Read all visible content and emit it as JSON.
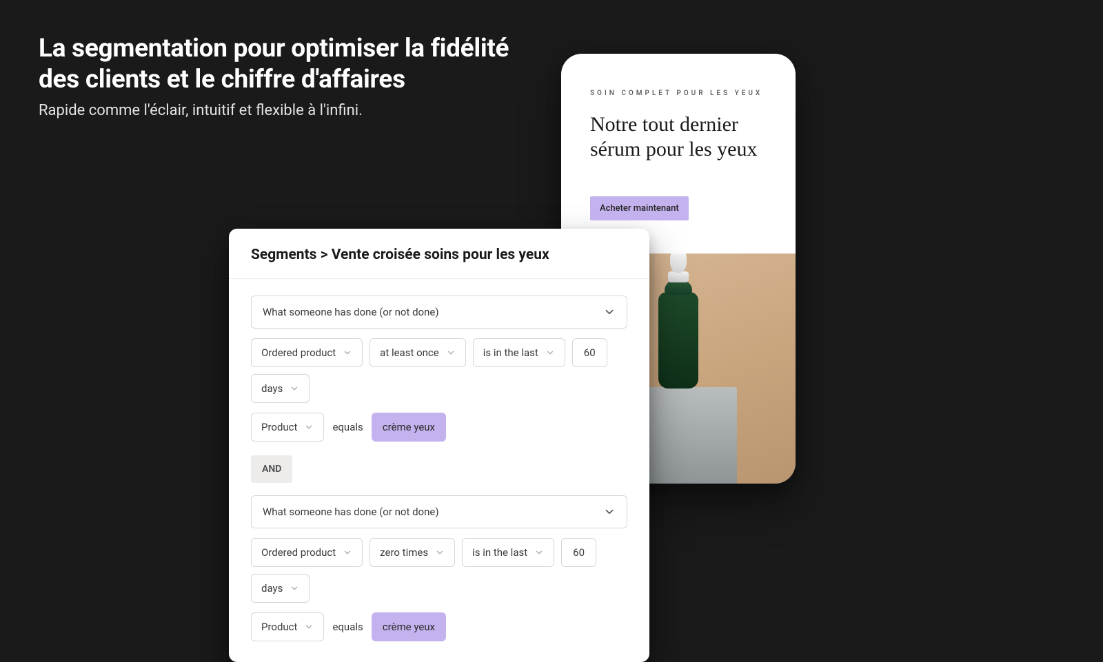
{
  "headline": {
    "title": "La segmentation pour optimiser la fidélité des clients et le chiffre d'affaires",
    "subtitle": "Rapide comme l'éclair, intuitif et flexible à l'infini."
  },
  "phone": {
    "eyebrow": "SOIN COMPLET POUR LES YEUX",
    "title": "Notre tout dernier sérum pour les yeux",
    "cta": "Acheter maintenant"
  },
  "segment_card": {
    "breadcrumb_root": "Segments",
    "breadcrumb_sep": " > ",
    "breadcrumb_name": "Vente croisée soins pour les yeux",
    "blocks": [
      {
        "condition": "What someone has done (or not done)",
        "event": "Ordered product",
        "frequency": "at least once",
        "timeframe": "is in the last",
        "count": "60",
        "unit": "days",
        "filter_field": "Product",
        "filter_op": "equals",
        "filter_value": "crème yeux"
      },
      {
        "condition": "What someone has done (or not done)",
        "event": "Ordered product",
        "frequency": "zero times",
        "timeframe": "is in the last",
        "count": "60",
        "unit": "days",
        "filter_field": "Product",
        "filter_op": "equals",
        "filter_value": "crème yeux"
      }
    ],
    "connector": "AND"
  }
}
